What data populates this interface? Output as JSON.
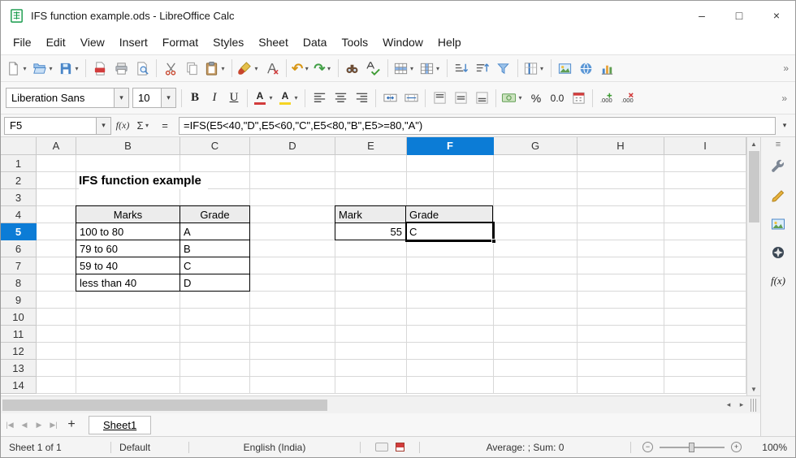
{
  "colors": {
    "accent": "#0c7cd6",
    "selection_border": "#000000",
    "gridline": "#d8d8d8",
    "table_border": "#000000"
  },
  "window": {
    "title": "IFS function example.ods - LibreOffice Calc",
    "minimize": "–",
    "maximize": "□",
    "close": "×"
  },
  "menu": {
    "items": [
      "File",
      "Edit",
      "View",
      "Insert",
      "Format",
      "Styles",
      "Sheet",
      "Data",
      "Tools",
      "Window",
      "Help"
    ]
  },
  "icons": {
    "dropdown": "▾",
    "undo": "↶",
    "redo": "↷",
    "up": "▲",
    "down": "▼",
    "left": "◂",
    "right": "▸",
    "menu": "≡",
    "overflow": "»"
  },
  "standard_toolbar": {
    "buttons": [
      "new-document",
      "open",
      "save",
      "export-as-pdf",
      "print",
      "print-preview",
      "cut",
      "copy",
      "paste",
      "clone-formatting",
      "clear-formatting",
      "undo",
      "redo",
      "find-and-replace",
      "spelling",
      "insert-row",
      "insert-column",
      "sort-ascending",
      "sort-descending",
      "autofilter",
      "freeze-rows-and-columns",
      "insert-image",
      "insert-hyperlink",
      "insert-chart"
    ]
  },
  "formatting_toolbar": {
    "font_name": "Liberation Sans",
    "font_size": "10",
    "bold": "B",
    "italic": "I",
    "underline": "U",
    "font_color_letter": "A",
    "highlight_letter": "A",
    "percent": "%",
    "number": "0.0",
    "buttons": [
      "font-name",
      "font-size",
      "bold",
      "italic",
      "underline",
      "font-color",
      "highlighting-color",
      "align-left",
      "align-center",
      "align-right",
      "merge-cells",
      "merge-and-center",
      "align-top",
      "center-vertically",
      "align-bottom",
      "format-as-currency",
      "format-as-percent",
      "format-as-number",
      "format-as-date",
      "add-decimal-place",
      "delete-decimal-place"
    ]
  },
  "formula_bar": {
    "name_box": "F5",
    "function_wizard": "f(x)",
    "sum": "Σ",
    "equals": "=",
    "formula": "=IFS(E5<40,\"D\",E5<60,\"C\",E5<80,\"B\",E5>=80,\"A\")"
  },
  "grid": {
    "columns": [
      "A",
      "B",
      "C",
      "D",
      "E",
      "F",
      "G",
      "H",
      "I"
    ],
    "rows": [
      "1",
      "2",
      "3",
      "4",
      "5",
      "6",
      "7",
      "8",
      "9",
      "10",
      "11",
      "12",
      "13",
      "14"
    ],
    "selected_cell": "F5",
    "selected_column": "F",
    "selected_row": "5",
    "title": "IFS function example",
    "lookup_table": {
      "headers": [
        "Marks",
        "Grade"
      ],
      "rows": [
        [
          "100 to 80",
          "A"
        ],
        [
          "79 to 60",
          "B"
        ],
        [
          "59 to 40",
          "C"
        ],
        [
          "less than 40",
          "D"
        ]
      ]
    },
    "result_table": {
      "headers": [
        "Mark",
        "Grade"
      ],
      "rows": [
        [
          "55",
          "C"
        ]
      ]
    }
  },
  "sheet_bar": {
    "nav_first": "|◀",
    "nav_prev": "◀",
    "nav_next": "▶",
    "nav_last": "▶|",
    "add_sheet": "+",
    "tabs": [
      {
        "label": "Sheet1",
        "active": true
      }
    ]
  },
  "status_bar": {
    "sheet_info": "Sheet 1 of 1",
    "page_style": "Default",
    "language": "English (India)",
    "stats": "Average: ; Sum: 0",
    "zoom_out": "−",
    "zoom_in": "+",
    "zoom_level": "100%"
  },
  "sidebar": {
    "items": [
      "properties",
      "styles",
      "gallery",
      "navigator",
      "functions"
    ],
    "functions_label": "f(x)"
  }
}
